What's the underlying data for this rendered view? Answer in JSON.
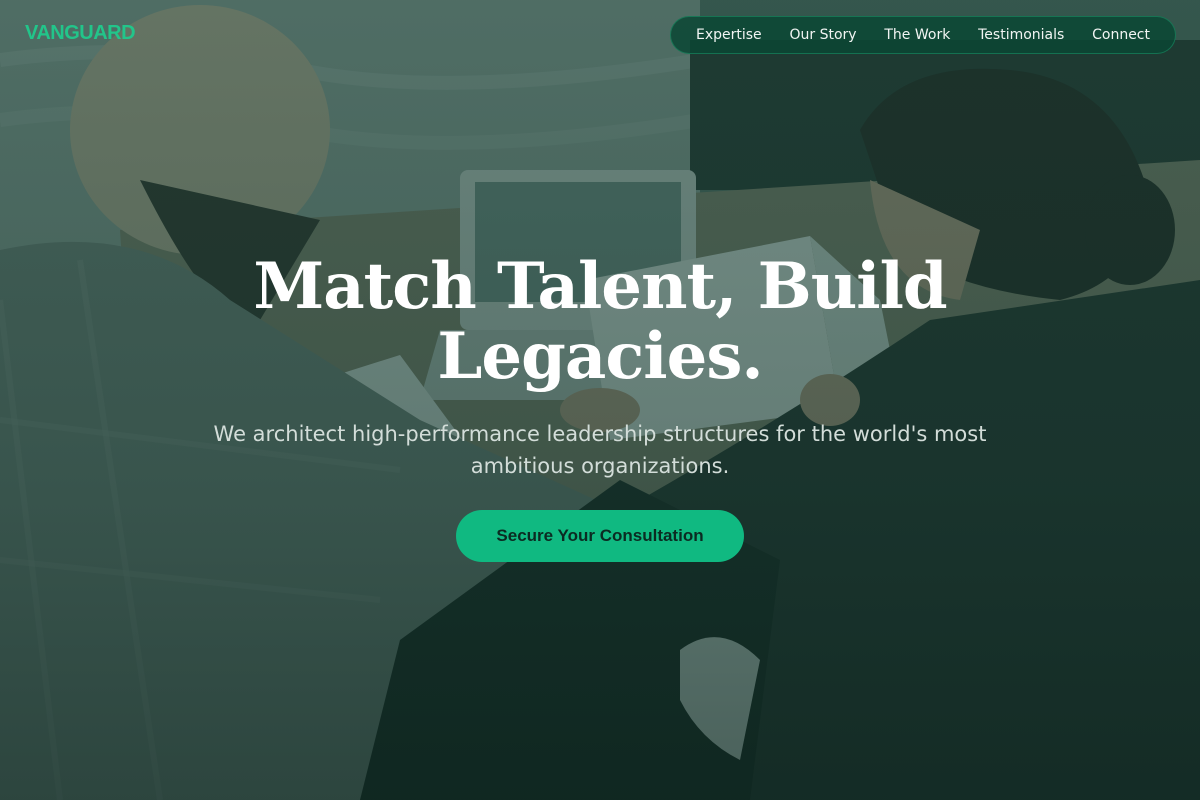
{
  "brand": {
    "logo_text": "VANGUARD",
    "accent_color": "#10b981"
  },
  "nav": {
    "items": [
      {
        "label": "Expertise"
      },
      {
        "label": "Our Story"
      },
      {
        "label": "The Work"
      },
      {
        "label": "Testimonials"
      },
      {
        "label": "Connect"
      }
    ]
  },
  "hero": {
    "headline_line1": "Match Talent, Build",
    "headline_line2": "Legacies.",
    "subtext": "We architect high-performance leadership structures for the world's most ambitious organizations.",
    "cta_label": "Secure Your Consultation",
    "background": "photo of two professionals reviewing documents and a laptop at a table, green tinted"
  }
}
